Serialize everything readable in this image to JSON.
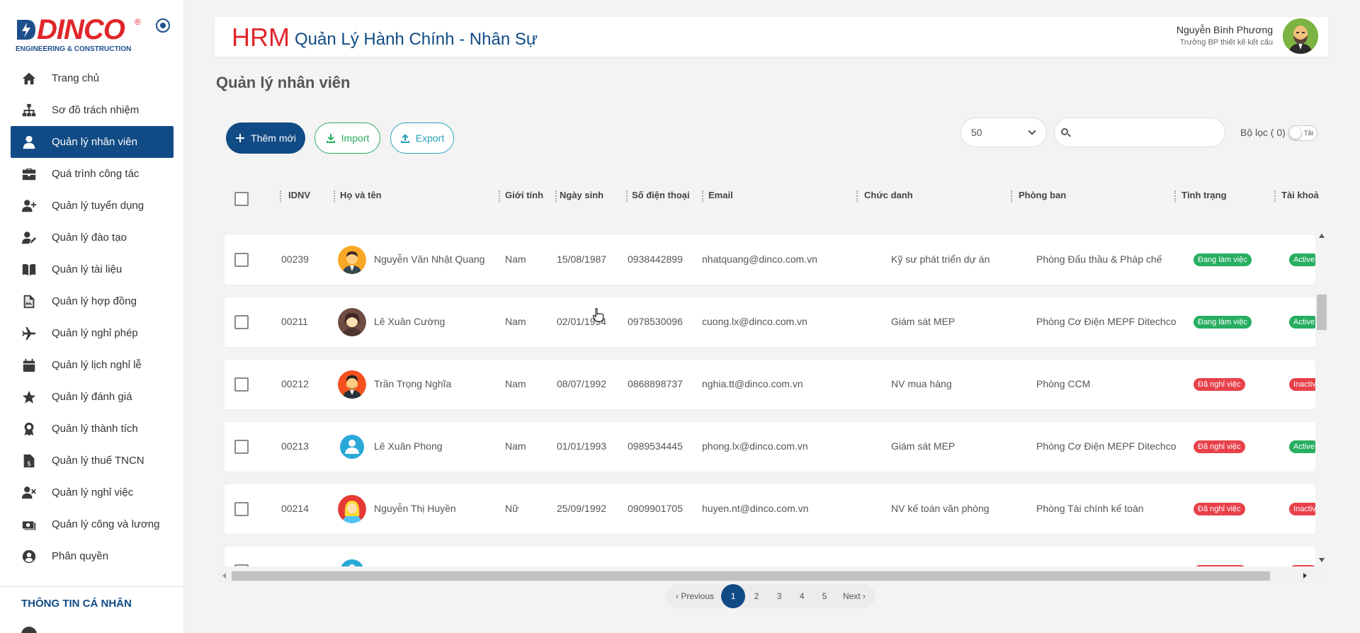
{
  "sidebar": {
    "brand": "DINCO",
    "brand_sub": "ENGINEERING & CONSTRUCTION",
    "items": [
      {
        "label": "Trang chủ",
        "icon": "home-icon"
      },
      {
        "label": "Sơ đồ trách nhiệm",
        "icon": "org-chart-icon"
      },
      {
        "label": "Quản lý nhân viên",
        "icon": "user-icon",
        "active": true
      },
      {
        "label": "Quá trình công tác",
        "icon": "briefcase-icon"
      },
      {
        "label": "Quản lý tuyển dụng",
        "icon": "user-plus-icon"
      },
      {
        "label": "Quản lý đào tạo",
        "icon": "user-edit-icon"
      },
      {
        "label": "Quản lý tài liệu",
        "icon": "book-icon"
      },
      {
        "label": "Quản lý hợp đồng",
        "icon": "contract-icon"
      },
      {
        "label": "Quản lý nghỉ phép",
        "icon": "plane-icon"
      },
      {
        "label": "Quản lý lịch nghỉ lễ",
        "icon": "calendar-icon"
      },
      {
        "label": "Quản lý đánh giá",
        "icon": "star-icon"
      },
      {
        "label": "Quản lý thành tích",
        "icon": "award-icon"
      },
      {
        "label": "Quản lý thuế TNCN",
        "icon": "tax-file-icon"
      },
      {
        "label": "Quản lý nghỉ việc",
        "icon": "user-times-icon"
      },
      {
        "label": "Quản lý công và lương",
        "icon": "money-icon"
      },
      {
        "label": "Phân quyền",
        "icon": "user-circle-icon"
      }
    ],
    "section_label": "THÔNG TIN CÁ NHÂN"
  },
  "header": {
    "brand": "HRM",
    "title": "Quản Lý Hành Chính - Nhân Sự",
    "user_name": "Nguyễn Bình Phương",
    "user_role": "Trưởng BP thiết kế kết cấu"
  },
  "page": {
    "title": "Quản lý nhân viên"
  },
  "toolbar": {
    "add_label": "Thêm mới",
    "import_label": "Import",
    "export_label": "Export",
    "page_size": "50",
    "search_placeholder": "",
    "filter_label": "Bộ lọc ( 0)",
    "toggle_label": "Tắt"
  },
  "table": {
    "columns": [
      "IDNV",
      "Họ và tên",
      "Giới tính",
      "Ngày sinh",
      "Số điện thoại",
      "Email",
      "Chức danh",
      "Phòng ban",
      "Tình trạng",
      "Tài khoả"
    ],
    "rows": [
      {
        "id": "00239",
        "name": "Nguyễn Văn Nhật Quang",
        "gender": "Nam",
        "dob": "15/08/1987",
        "phone": "0938442899",
        "email": "nhatquang@dinco.com.vn",
        "title": "Kỹ sư phát triển dự án",
        "dept": "Phòng Đấu thầu & Pháp chế",
        "status": "Đang làm việc",
        "status_color": "#27ae60",
        "account": "Active",
        "account_color": "#27ae60"
      },
      {
        "id": "00211",
        "name": "Lê Xuân Cường",
        "gender": "Nam",
        "dob": "02/01/1994",
        "phone": "0978530096",
        "email": "cuong.lx@dinco.com.vn",
        "title": "Giám sát MEP",
        "dept": "Phòng Cơ Điện MEPF Ditechco",
        "status": "Đang làm việc",
        "status_color": "#27ae60",
        "account": "Active",
        "account_color": "#27ae60"
      },
      {
        "id": "00212",
        "name": "Trần Trọng Nghĩa",
        "gender": "Nam",
        "dob": "08/07/1992",
        "phone": "0868898737",
        "email": "nghia.tt@dinco.com.vn",
        "title": "NV mua hàng",
        "dept": "Phòng CCM",
        "status": "Đã nghỉ việc",
        "status_color": "#e8414a",
        "account": "Inactiv",
        "account_color": "#e8414a"
      },
      {
        "id": "00213",
        "name": "Lê Xuân Phong",
        "gender": "Nam",
        "dob": "01/01/1993",
        "phone": "0989534445",
        "email": "phong.lx@dinco.com.vn",
        "title": "Giám sát MEP",
        "dept": "Phòng Cơ Điện MEPF Ditechco",
        "status": "Đã nghỉ việc",
        "status_color": "#e8414a",
        "account": "Active",
        "account_color": "#27ae60"
      },
      {
        "id": "00214",
        "name": "Nguyễn Thị Huyền",
        "gender": "Nữ",
        "dob": "25/09/1992",
        "phone": "0909901705",
        "email": "huyen.nt@dinco.com.vn",
        "title": "NV kế toán văn phòng",
        "dept": "Phòng Tài chính kế toán",
        "status": "Đã nghỉ việc",
        "status_color": "#e8414a",
        "account": "Inactiv",
        "account_color": "#e8414a"
      }
    ]
  },
  "pagination": {
    "prev": "Previous",
    "next": "Next",
    "pages": [
      "1",
      "2",
      "3",
      "4",
      "5"
    ],
    "current": "1"
  },
  "colors": {
    "primary": "#114b85",
    "brand_red": "#e0262b",
    "success": "#27ae60",
    "danger": "#e8414a"
  }
}
